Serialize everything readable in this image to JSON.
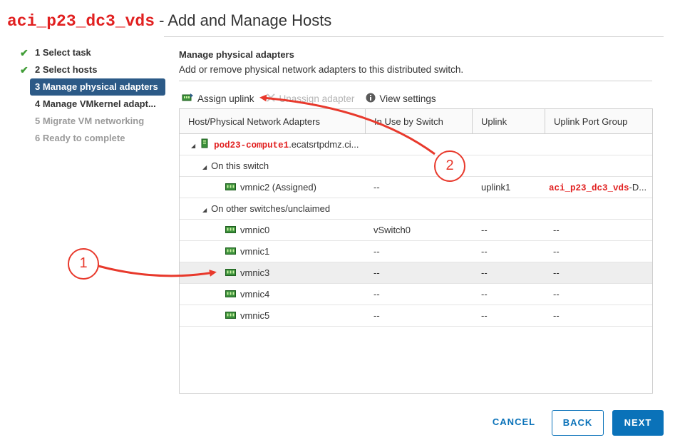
{
  "title": {
    "switch_name": "aci_p23_dc3_vds",
    "rest": " - Add and Manage Hosts"
  },
  "steps": [
    {
      "label": "1 Select task",
      "state": "done"
    },
    {
      "label": "2 Select hosts",
      "state": "done"
    },
    {
      "label": "3 Manage physical adapters",
      "state": "active"
    },
    {
      "label": "4 Manage VMkernel adapt...",
      "state": "pending"
    },
    {
      "label": "5 Migrate VM networking",
      "state": "future"
    },
    {
      "label": "6 Ready to complete",
      "state": "future"
    }
  ],
  "section": {
    "title": "Manage physical adapters",
    "description": "Add or remove physical network adapters to this distributed switch."
  },
  "toolbar": {
    "assign_uplink": "Assign uplink",
    "unassign_adapter": "Unassign adapter",
    "view_settings": "View settings"
  },
  "grid": {
    "headers": [
      "Host/Physical Network Adapters",
      "In Use by Switch",
      "Uplink",
      "Uplink Port Group"
    ],
    "host": {
      "name": "pod23-compute1",
      "domain": ".ecatsrtpdmz.ci..."
    },
    "groups": {
      "on_switch": "On this switch",
      "other": "On other switches/unclaimed"
    },
    "assigned": {
      "name": "vmnic2 (Assigned)",
      "in_use": "--",
      "uplink": "uplink1",
      "port_group": "aci_p23_dc3_vds",
      "port_group_suffix": "-D..."
    },
    "other_rows": [
      {
        "name": "vmnic0",
        "in_use": "vSwitch0",
        "uplink": "--",
        "port_group": "--"
      },
      {
        "name": "vmnic1",
        "in_use": "--",
        "uplink": "--",
        "port_group": "--"
      },
      {
        "name": "vmnic3",
        "in_use": "--",
        "uplink": "--",
        "port_group": "--",
        "selected": true
      },
      {
        "name": "vmnic4",
        "in_use": "--",
        "uplink": "--",
        "port_group": "--"
      },
      {
        "name": "vmnic5",
        "in_use": "--",
        "uplink": "--",
        "port_group": "--"
      }
    ]
  },
  "buttons": {
    "cancel": "CANCEL",
    "back": "BACK",
    "next": "NEXT"
  },
  "annotations": {
    "badge1": "1",
    "badge2": "2"
  },
  "colors": {
    "accent": "#0a72b9",
    "active_step": "#2c5a87",
    "annotation": "#e8392c",
    "host_name": "#e12020"
  }
}
